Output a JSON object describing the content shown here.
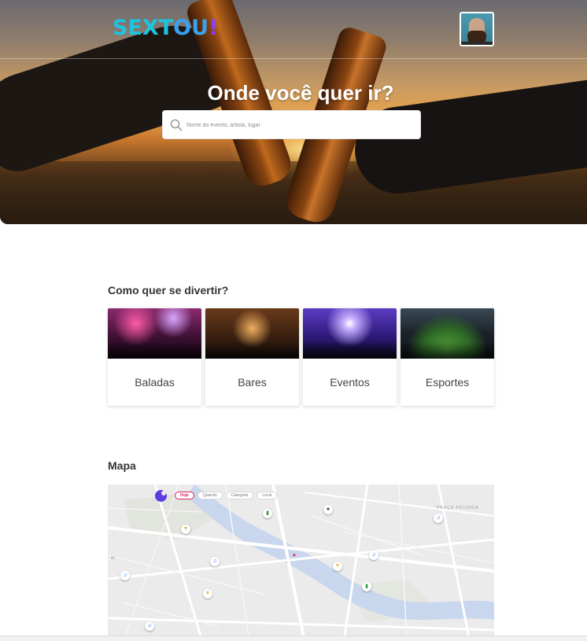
{
  "header": {
    "logo": {
      "part1": "SEXT",
      "part2": "OU",
      "part3": "!"
    },
    "avatar_alt": "user-avatar"
  },
  "hero": {
    "title": "Onde você quer ir?",
    "search": {
      "placeholder": "Nome do evento, artista, lugar",
      "value": ""
    }
  },
  "categories": {
    "title": "Como quer se divertir?",
    "items": [
      {
        "label": "Baladas"
      },
      {
        "label": "Bares"
      },
      {
        "label": "Eventos"
      },
      {
        "label": "Esportes"
      }
    ]
  },
  "map": {
    "title": "Mapa",
    "filters": [
      "Hoje",
      "Quando",
      "Categoria",
      "Local"
    ],
    "active_filter": "Hoje",
    "street_labels": [
      "PRAÇA POLONIA",
      "W"
    ],
    "pins": [
      {
        "icon": "sport-icon"
      },
      {
        "icon": "ball-icon"
      },
      {
        "icon": "music-icon"
      },
      {
        "icon": "beer-icon"
      },
      {
        "icon": "music-icon"
      },
      {
        "icon": "event-icon"
      },
      {
        "icon": "beer-icon"
      },
      {
        "icon": "music-icon"
      },
      {
        "icon": "music-icon"
      },
      {
        "icon": "beer-icon"
      },
      {
        "icon": "sport-icon"
      },
      {
        "icon": "music-icon"
      }
    ]
  },
  "colors": {
    "brand_cyan": "#1ec3e0",
    "brand_purple": "#8b3ff2",
    "map_active_chip": "#e0245e"
  }
}
